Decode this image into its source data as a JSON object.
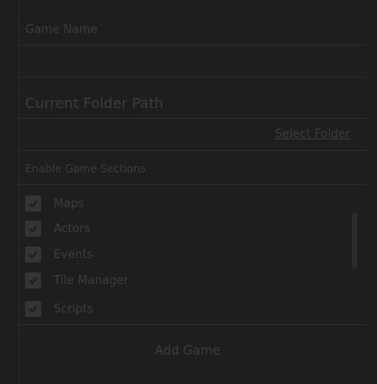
{
  "form": {
    "name_label": "Game Name",
    "name_value": "",
    "folder_value": "Current Folder Path",
    "select_folder_label": "Select Folder",
    "sections_title": "Enable Game Sections"
  },
  "sections": [
    {
      "label": "Maps",
      "checked": true
    },
    {
      "label": "Actors",
      "checked": true
    },
    {
      "label": "Events",
      "checked": true
    },
    {
      "label": "Tile Manager",
      "checked": true
    },
    {
      "label": "Scripts",
      "checked": true
    }
  ],
  "actions": {
    "add_game_label": "Add Game"
  }
}
